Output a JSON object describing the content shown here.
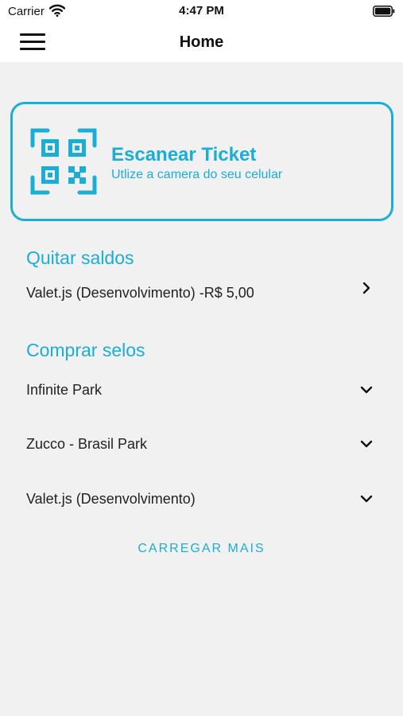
{
  "status_bar": {
    "carrier": "Carrier",
    "time": "4:47 PM"
  },
  "nav": {
    "title": "Home"
  },
  "scan": {
    "title": "Escanear Ticket",
    "subtitle": "Utlize a camera do seu celular"
  },
  "balances": {
    "title": "Quitar saldos",
    "items": [
      {
        "label": "Valet.js (Desenvolvimento) -R$ 5,00"
      }
    ]
  },
  "stamps": {
    "title": "Comprar selos",
    "items": [
      {
        "label": "Infinite Park"
      },
      {
        "label": "Zucco - Brasil Park"
      },
      {
        "label": "Valet.js (Desenvolvimento)"
      }
    ]
  },
  "load_more": {
    "label": "CARREGAR MAIS"
  },
  "colors": {
    "accent": "#1aaed6",
    "background": "#f1f1f1"
  }
}
